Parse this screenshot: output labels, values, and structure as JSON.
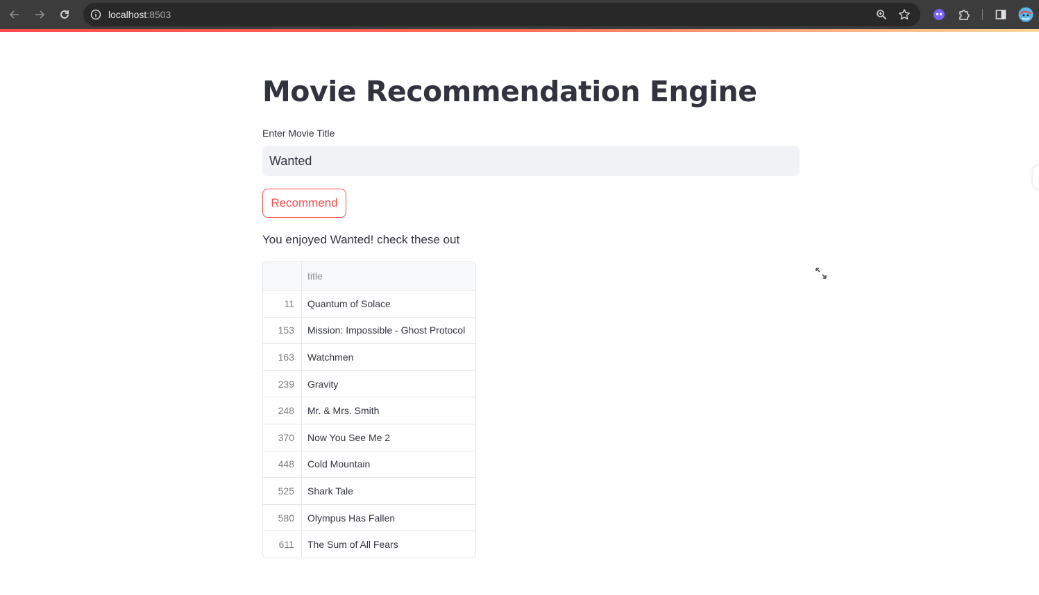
{
  "browser": {
    "url_host": "localhost",
    "url_port": ":8503",
    "icons": [
      "back-arrow-icon",
      "forward-arrow-icon",
      "reload-icon",
      "site-info-icon",
      "zoom-icon",
      "bookmark-star-icon",
      "extension-ghost-icon",
      "extensions-puzzle-icon",
      "side-panel-icon",
      "profile-avatar-icon"
    ]
  },
  "page": {
    "title": "Movie Recommendation Engine",
    "input_label": "Enter Movie Title",
    "input_value": "Wanted",
    "button_label": "Recommend",
    "result_text": "You enjoyed Wanted! check these out"
  },
  "dataframe": {
    "column_header": "title",
    "rows": [
      {
        "index": "11",
        "title": "Quantum of Solace"
      },
      {
        "index": "153",
        "title": "Mission: Impossible - Ghost Protocol"
      },
      {
        "index": "163",
        "title": "Watchmen"
      },
      {
        "index": "239",
        "title": "Gravity"
      },
      {
        "index": "248",
        "title": "Mr. & Mrs. Smith"
      },
      {
        "index": "370",
        "title": "Now You See Me 2"
      },
      {
        "index": "448",
        "title": "Cold Mountain"
      },
      {
        "index": "525",
        "title": "Shark Tale"
      },
      {
        "index": "580",
        "title": "Olympus Has Fallen"
      },
      {
        "index": "611",
        "title": "The Sum of All Fears"
      }
    ]
  },
  "colors": {
    "accent": "#ff4b4b",
    "text": "#31333f",
    "input_bg": "#f0f2f6"
  }
}
